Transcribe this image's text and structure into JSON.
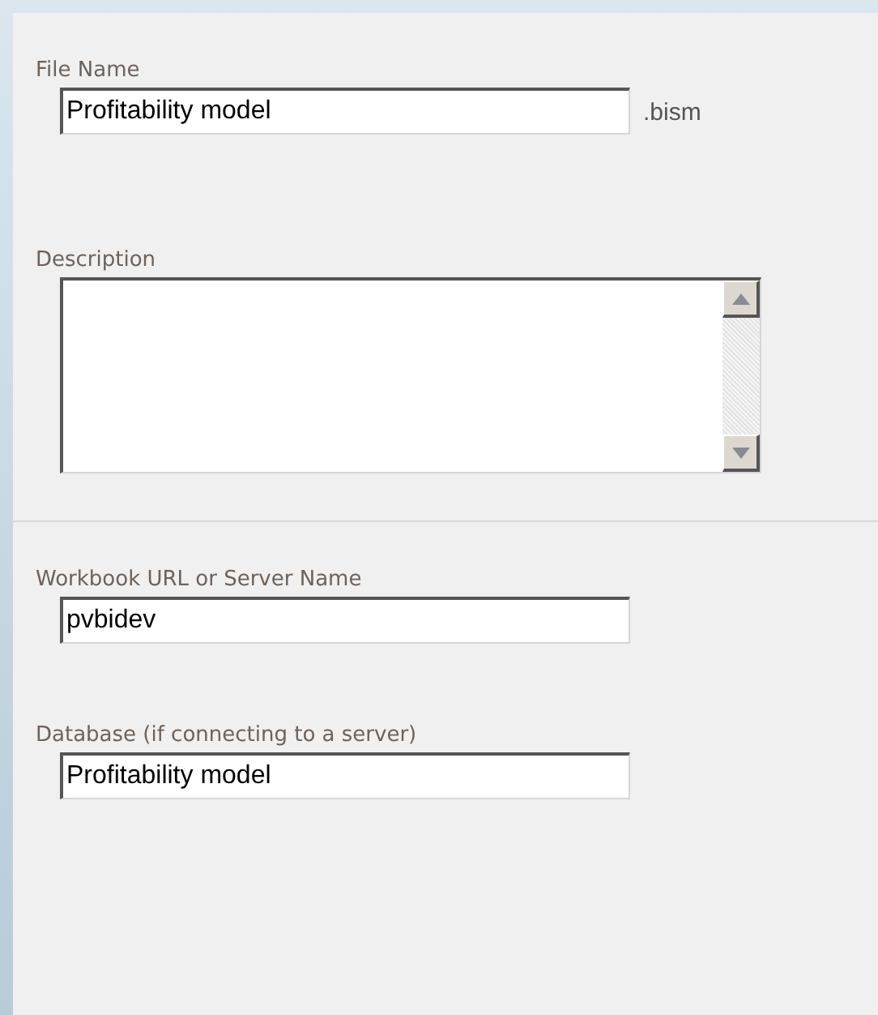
{
  "sections": [
    {
      "fields": [
        {
          "kind": "text",
          "label": "File Name",
          "value": "Profitability model",
          "suffix": ".bism"
        },
        {
          "kind": "textarea",
          "label": "Description"
        }
      ]
    },
    {
      "fields": [
        {
          "kind": "text",
          "label": "Workbook URL or Server Name",
          "value": "pvbidev"
        },
        {
          "kind": "text",
          "label": "Database (if connecting to a server)",
          "value": "Profitability model"
        }
      ]
    }
  ]
}
